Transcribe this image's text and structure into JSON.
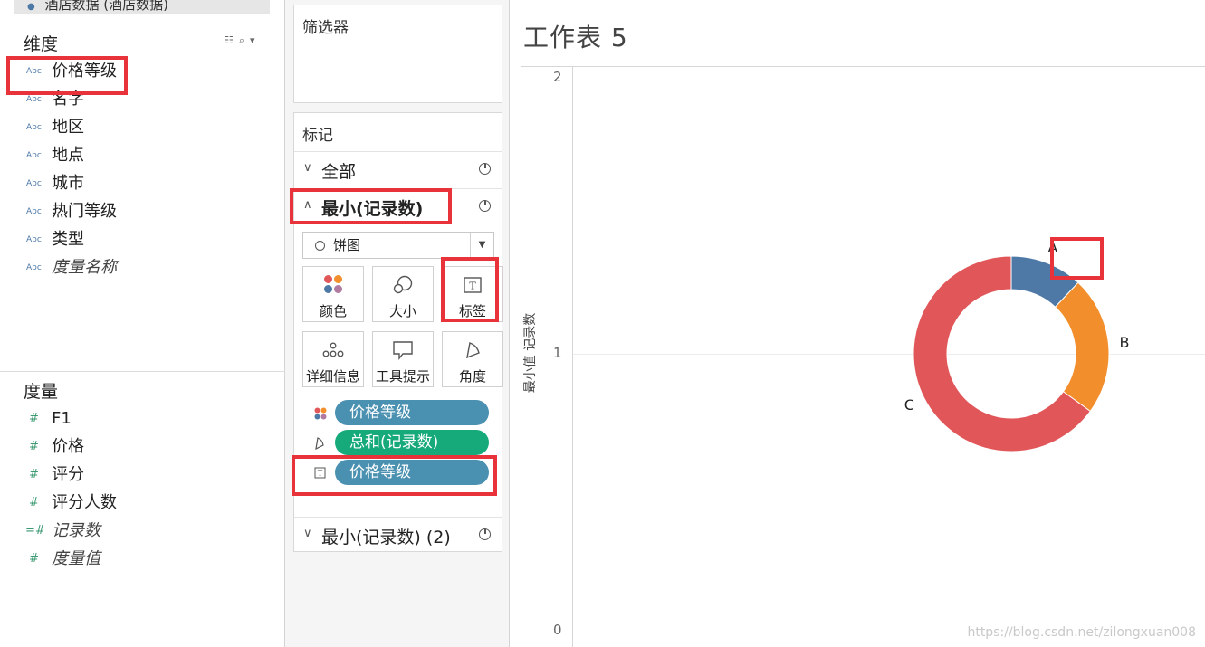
{
  "datasource": {
    "name": "酒店数据 (酒店数据)"
  },
  "dimensions": {
    "header": "维度",
    "fields": [
      {
        "type": "Abc",
        "name": "价格等级",
        "italic": false
      },
      {
        "type": "Abc",
        "name": "名字",
        "italic": false
      },
      {
        "type": "Abc",
        "name": "地区",
        "italic": false
      },
      {
        "type": "Abc",
        "name": "地点",
        "italic": false
      },
      {
        "type": "Abc",
        "name": "城市",
        "italic": false
      },
      {
        "type": "Abc",
        "name": "热门等级",
        "italic": false
      },
      {
        "type": "Abc",
        "name": "类型",
        "italic": false
      },
      {
        "type": "Abc",
        "name": "度量名称",
        "italic": true
      }
    ]
  },
  "measures": {
    "header": "度量",
    "fields": [
      {
        "type": "#",
        "name": "F1",
        "italic": false
      },
      {
        "type": "#",
        "name": "价格",
        "italic": false
      },
      {
        "type": "#",
        "name": "评分",
        "italic": false
      },
      {
        "type": "#",
        "name": "评分人数",
        "italic": false
      },
      {
        "type": "=#",
        "name": "记录数",
        "italic": true
      },
      {
        "type": "#",
        "name": "度量值",
        "italic": true
      }
    ]
  },
  "filters": {
    "title": "筛选器"
  },
  "marks": {
    "title": "标记",
    "all_label": "全部",
    "active_layer_label": "最小(记录数)",
    "second_layer_label": "最小(记录数) (2)",
    "mark_type": "饼图",
    "buttons": {
      "color": "颜色",
      "size": "大小",
      "label": "标签",
      "detail": "详细信息",
      "tooltip": "工具提示",
      "angle": "角度"
    },
    "pills": [
      {
        "shelf": "color",
        "field": "价格等级"
      },
      {
        "shelf": "angle",
        "field": "总和(记录数)"
      },
      {
        "shelf": "label",
        "field": "价格等级"
      }
    ]
  },
  "worksheet": {
    "title": "工作表 5"
  },
  "chart_data": {
    "type": "pie",
    "categories": [
      "A",
      "B",
      "C"
    ],
    "values": [
      12,
      23,
      65
    ],
    "colors": [
      "#4e79a7",
      "#f28e2b",
      "#e15759"
    ],
    "ylabel": "最小值 记录数",
    "yticks": [
      "2",
      "1",
      "0"
    ],
    "ylim": [
      0,
      2
    ]
  },
  "watermark": "https://blog.csdn.net/zilongxuan008"
}
